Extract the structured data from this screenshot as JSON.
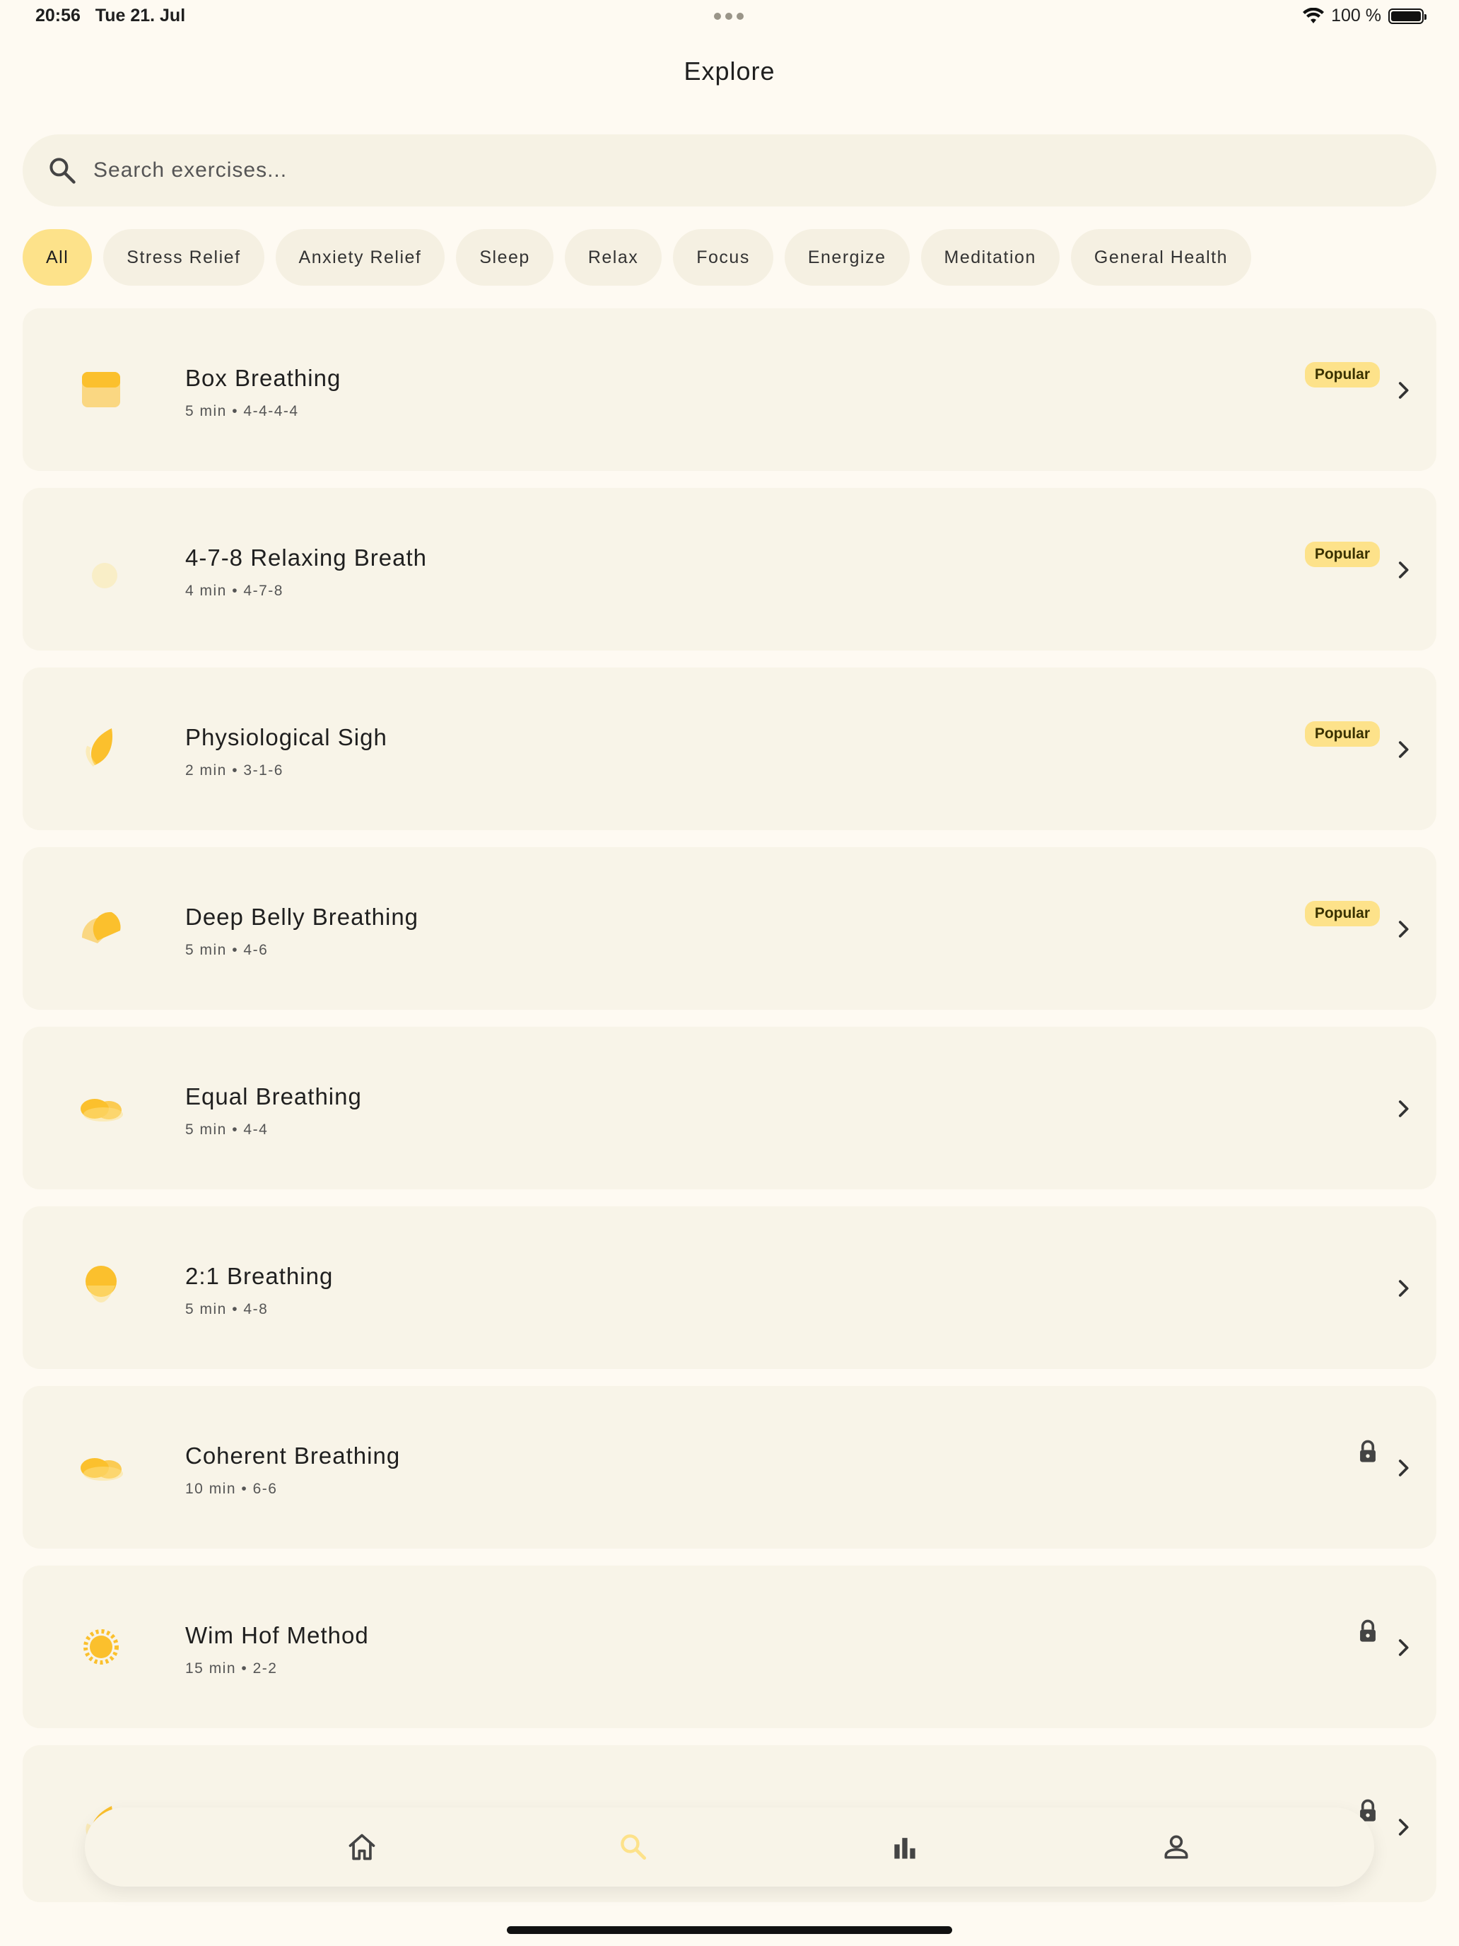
{
  "status_bar": {
    "time": "20:56",
    "date": "Tue 21. Jul",
    "battery": "100 %"
  },
  "page": {
    "title": "Explore"
  },
  "search": {
    "placeholder": "Search exercises..."
  },
  "filters": [
    "All",
    "Stress Relief",
    "Anxiety Relief",
    "Sleep",
    "Relax",
    "Focus",
    "Energize",
    "Meditation",
    "General Health"
  ],
  "selected_filter": "All",
  "exercises": [
    {
      "title": "Box Breathing",
      "duration": "5 min",
      "pattern": "4-4-4-4",
      "badge": "Popular",
      "locked": false,
      "icon": "box-icon"
    },
    {
      "title": "4-7-8 Relaxing Breath",
      "duration": "4 min",
      "pattern": "4-7-8",
      "badge": "Popular",
      "locked": false,
      "icon": "moon-icon"
    },
    {
      "title": "Physiological Sigh",
      "duration": "2 min",
      "pattern": "3-1-6",
      "badge": "Popular",
      "locked": false,
      "icon": "leaf-icon"
    },
    {
      "title": "Deep Belly Breathing",
      "duration": "5 min",
      "pattern": "4-6",
      "badge": "Popular",
      "locked": false,
      "icon": "orange-slice-icon"
    },
    {
      "title": "Equal Breathing",
      "duration": "5 min",
      "pattern": "4-4",
      "badge": "",
      "locked": false,
      "icon": "cloud-icon"
    },
    {
      "title": "2:1 Breathing",
      "duration": "5 min",
      "pattern": "4-8",
      "badge": "",
      "locked": false,
      "icon": "drop-icon"
    },
    {
      "title": "Coherent Breathing",
      "duration": "10 min",
      "pattern": "6-6",
      "badge": "",
      "locked": true,
      "icon": "cloud-icon"
    },
    {
      "title": "Wim Hof Method",
      "duration": "15 min",
      "pattern": "2-2",
      "badge": "",
      "locked": true,
      "icon": "sun-icon"
    },
    {
      "title": "",
      "duration": "",
      "pattern": "",
      "badge": "",
      "locked": true,
      "icon": "leaf-icon"
    }
  ],
  "bottom_nav": [
    {
      "name": "home",
      "icon": "home-icon",
      "active": false
    },
    {
      "name": "explore",
      "icon": "search-icon",
      "active": true
    },
    {
      "name": "stats",
      "icon": "bar-chart-icon",
      "active": false
    },
    {
      "name": "profile",
      "icon": "person-icon",
      "active": false
    }
  ],
  "colors": {
    "background": "#fefaf2",
    "card": "#f8f4e8",
    "accent": "#fde28a",
    "icon_yellow": "#fbc02d",
    "text": "#1f1f1f"
  }
}
